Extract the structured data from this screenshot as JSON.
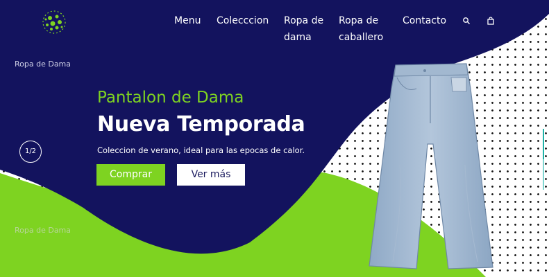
{
  "nav": {
    "items": [
      {
        "label_line1": "Menu",
        "label_line2": ""
      },
      {
        "label_line1": "Colecccion",
        "label_line2": ""
      },
      {
        "label_line1": "Ropa de",
        "label_line2": "dama"
      },
      {
        "label_line1": "Ropa de",
        "label_line2": "caballero"
      },
      {
        "label_line1": "Contacto",
        "label_line2": ""
      }
    ],
    "icons": [
      "search-icon",
      "shopping-bag-icon"
    ]
  },
  "side_labels": {
    "top": "Ropa de Dama",
    "bottom": "Ropa de Dama"
  },
  "slider": {
    "counter": "1/2",
    "progress": 0.5
  },
  "hero": {
    "eyebrow": "Pantalon de Dama",
    "title": "Nueva Temporada",
    "subtitle": "Coleccion de verano, ideal para las epocas de calor.",
    "primary_button": "Comprar",
    "secondary_button": "Ver más"
  },
  "colors": {
    "navy": "#13135e",
    "green": "#7ed321",
    "white": "#ffffff",
    "denim": "#9db5cf"
  }
}
